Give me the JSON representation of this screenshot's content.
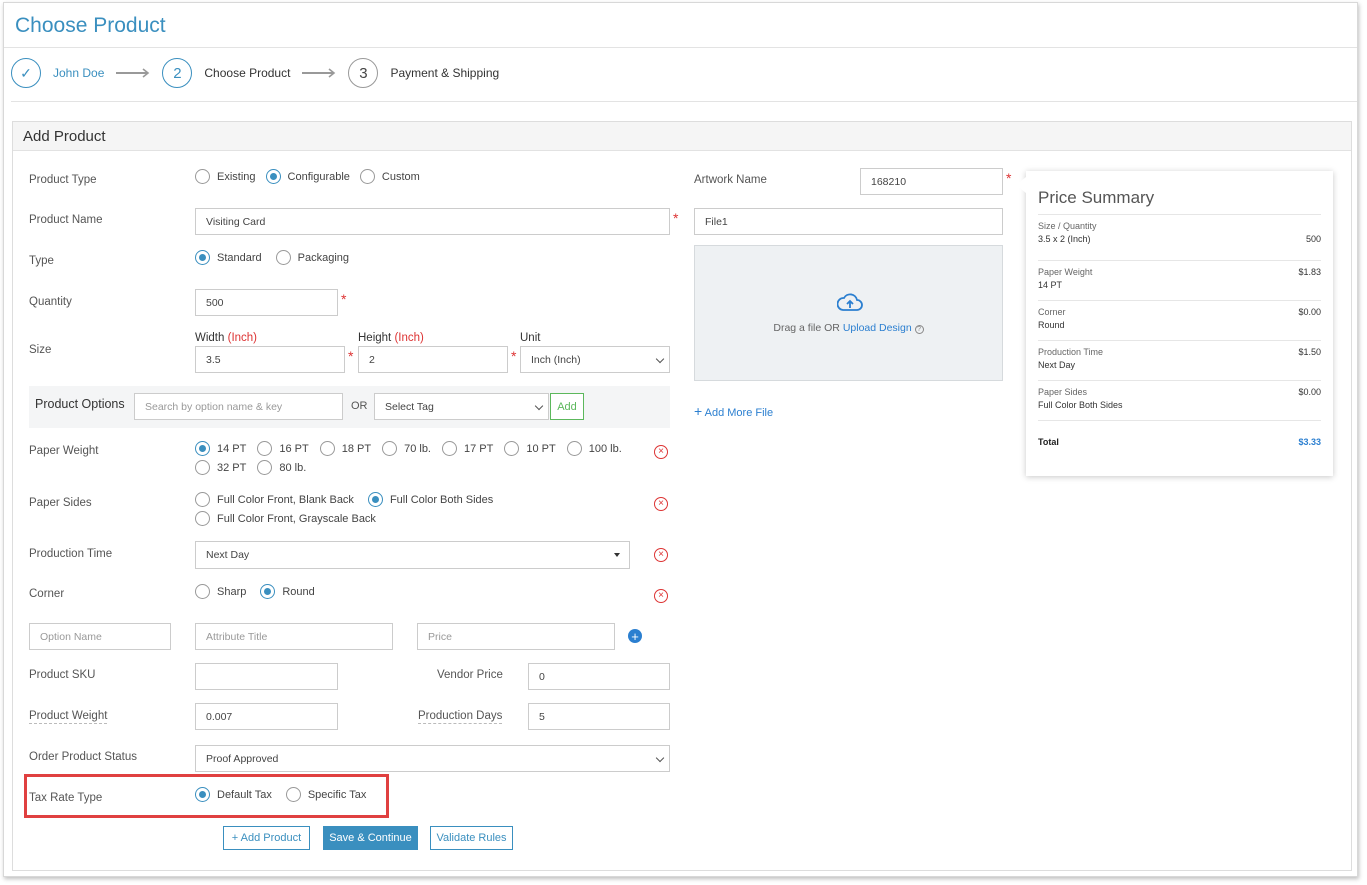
{
  "page_title": "Choose Product",
  "steps": [
    {
      "number": "✓",
      "label": "John Doe"
    },
    {
      "number": "2",
      "label": "Choose Product"
    },
    {
      "number": "3",
      "label": "Payment & Shipping"
    }
  ],
  "panel_title": "Add Product",
  "form": {
    "product_type": {
      "label": "Product Type",
      "options": [
        "Existing",
        "Configurable",
        "Custom"
      ],
      "selected": "Configurable"
    },
    "product_name": {
      "label": "Product Name",
      "value": "Visiting Card"
    },
    "type": {
      "label": "Type",
      "options": [
        "Standard",
        "Packaging"
      ],
      "selected": "Standard"
    },
    "quantity": {
      "label": "Quantity",
      "value": "500"
    },
    "size": {
      "label": "Size",
      "width_label": "Width",
      "width_unit": "(Inch)",
      "width_value": "3.5",
      "height_label": "Height",
      "height_unit": "(Inch)",
      "height_value": "2",
      "unit_label": "Unit",
      "unit_value": "Inch (Inch)"
    },
    "product_options": {
      "label": "Product Options",
      "search_placeholder": "Search by option name & key",
      "or": "OR",
      "tag_value": "Select Tag",
      "add_label": "Add"
    },
    "paper_weight": {
      "label": "Paper Weight",
      "options": [
        "14 PT",
        "16 PT",
        "18 PT",
        "70 lb.",
        "17 PT",
        "10 PT",
        "100 lb.",
        "32 PT",
        "80 lb."
      ],
      "selected": "14 PT"
    },
    "paper_sides": {
      "label": "Paper Sides",
      "options": [
        "Full Color Front, Blank Back",
        "Full Color Both Sides",
        "Full Color Front, Grayscale Back"
      ],
      "selected": "Full Color Both Sides"
    },
    "production_time": {
      "label": "Production Time",
      "value": "Next Day"
    },
    "corner": {
      "label": "Corner",
      "options": [
        "Sharp",
        "Round"
      ],
      "selected": "Round"
    },
    "custom_option": {
      "option_name_placeholder": "Option Name",
      "attribute_title_placeholder": "Attribute Title",
      "price_placeholder": "Price"
    },
    "product_sku": {
      "label": "Product SKU",
      "value": ""
    },
    "vendor_price": {
      "label": "Vendor Price",
      "value": "0"
    },
    "product_weight": {
      "label": "Product Weight",
      "value": "0.007"
    },
    "production_days": {
      "label": "Production Days",
      "value": "5"
    },
    "order_status": {
      "label": "Order Product Status",
      "value": "Proof Approved"
    },
    "tax_rate_type": {
      "label": "Tax Rate Type",
      "options": [
        "Default Tax",
        "Specific Tax"
      ],
      "selected": "Default Tax"
    }
  },
  "buttons": {
    "add_product": "+ Add Product",
    "save_continue": "Save & Continue",
    "validate_rules": "Validate Rules"
  },
  "artwork": {
    "label": "Artwork Name",
    "value": "168210",
    "file_name": "File1",
    "drop_text": "Drag a file OR",
    "upload_link": "Upload Design",
    "add_more": "Add More File"
  },
  "price_summary": {
    "title": "Price Summary",
    "rows": [
      {
        "key": "Size / Quantity",
        "value": "3.5 x 2 (Inch)",
        "price": "500"
      },
      {
        "key": "Paper Weight",
        "value": "14 PT",
        "price": "$1.83"
      },
      {
        "key": "Corner",
        "value": "Round",
        "price": "$0.00"
      },
      {
        "key": "Production Time",
        "value": "Next Day",
        "price": "$1.50"
      },
      {
        "key": "Paper Sides",
        "value": "Full Color Both Sides",
        "price": "$0.00"
      }
    ],
    "total_label": "Total",
    "total_value": "$3.33"
  },
  "colors": {
    "accent": "#3a8fbf",
    "required": "#dd3333",
    "highlight": "#e04040"
  }
}
